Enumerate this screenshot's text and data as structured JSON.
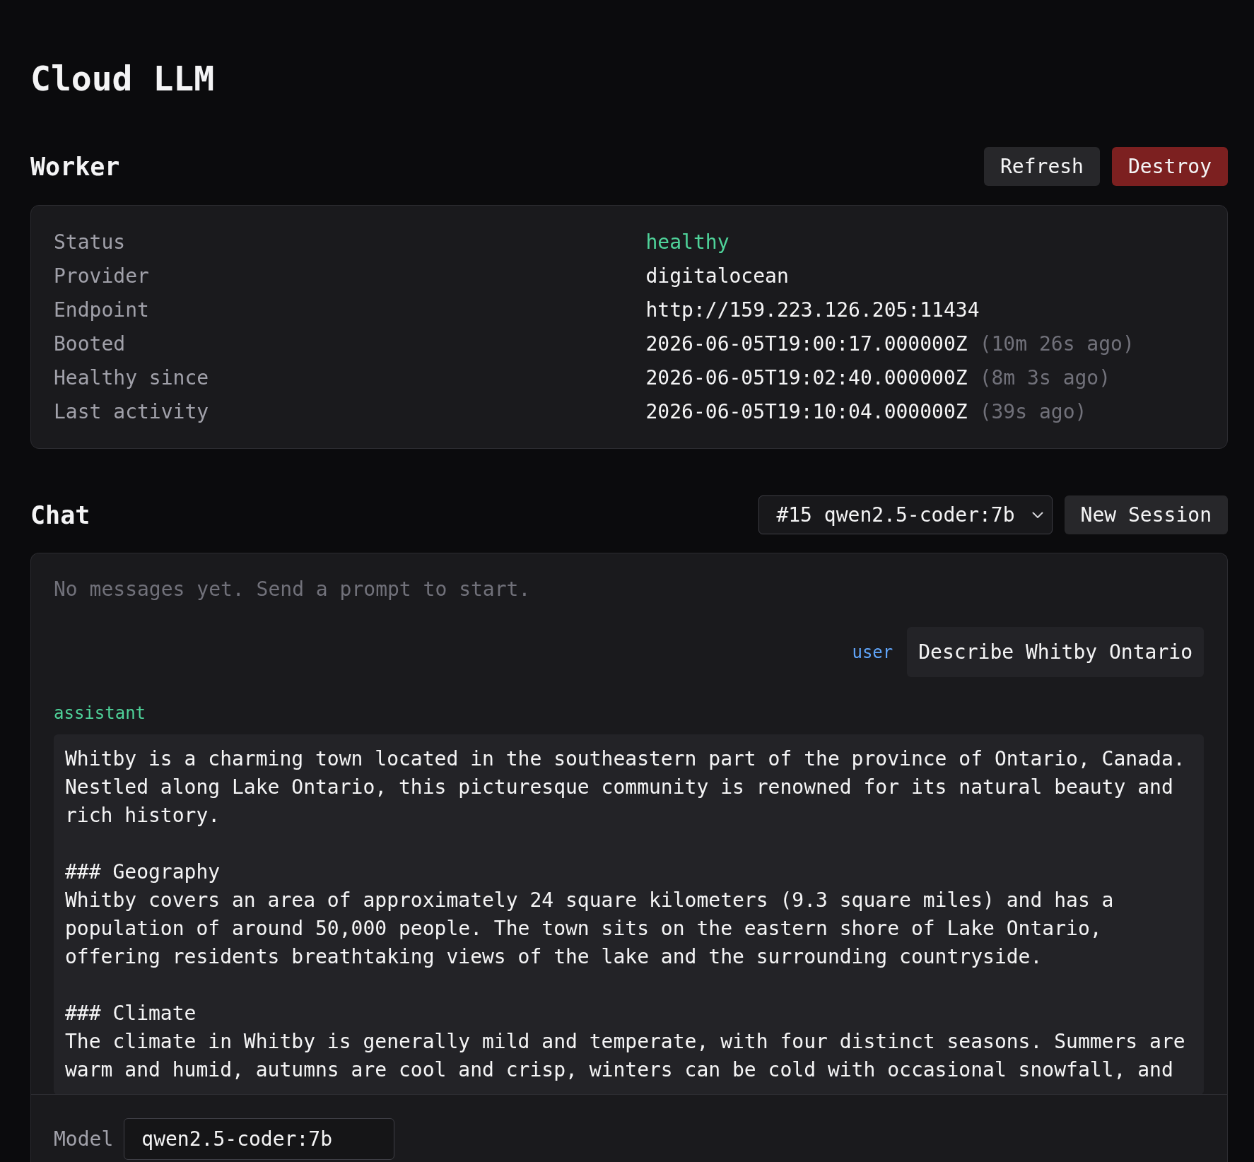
{
  "title": "Cloud LLM",
  "worker": {
    "heading": "Worker",
    "buttons": [
      {
        "label": "Refresh",
        "kind": "default"
      },
      {
        "label": "Destroy",
        "kind": "danger"
      }
    ],
    "fields": [
      {
        "label": "Status",
        "value": "healthy",
        "kind": "status"
      },
      {
        "label": "Provider",
        "value": "digitalocean",
        "kind": "text"
      },
      {
        "label": "Endpoint",
        "value": "http://159.223.126.205:11434",
        "kind": "text"
      },
      {
        "label": "Booted",
        "value": "2026-06-05T19:00:17.000000Z",
        "ago": "(10m 26s ago)",
        "kind": "time"
      },
      {
        "label": "Healthy since",
        "value": "2026-06-05T19:02:40.000000Z",
        "ago": "(8m 3s ago)",
        "kind": "time"
      },
      {
        "label": "Last activity",
        "value": "2026-06-05T19:10:04.000000Z",
        "ago": "(39s ago)",
        "kind": "time"
      }
    ]
  },
  "chat": {
    "heading": "Chat",
    "session_select": {
      "value": "#15 qwen2.5-coder:7b"
    },
    "new_session_button": {
      "label": "New Session"
    },
    "empty_note": "No messages yet. Send a prompt to start.",
    "messages": [
      {
        "kind": "user",
        "role": "user",
        "text": "Describe Whitby Ontario"
      },
      {
        "kind": "assistant",
        "role": "assistant",
        "text": "Whitby is a charming town located in the southeastern part of the province of Ontario, Canada. Nestled along Lake Ontario, this picturesque community is renowned for its natural beauty and rich history.\n\n### Geography\nWhitby covers an area of approximately 24 square kilometers (9.3 square miles) and has a population of around 50,000 people. The town sits on the eastern shore of Lake Ontario, offering residents breathtaking views of the lake and the surrounding countryside.\n\n### Climate\nThe climate in Whitby is generally mild and temperate, with four distinct seasons. Summers are warm and humid, autumns are cool and crisp, winters can be cold with occasional snowfall, and"
      }
    ],
    "footer": {
      "model_label": "Model",
      "model_input": {
        "value": "qwen2.5-coder:7b"
      }
    }
  }
}
